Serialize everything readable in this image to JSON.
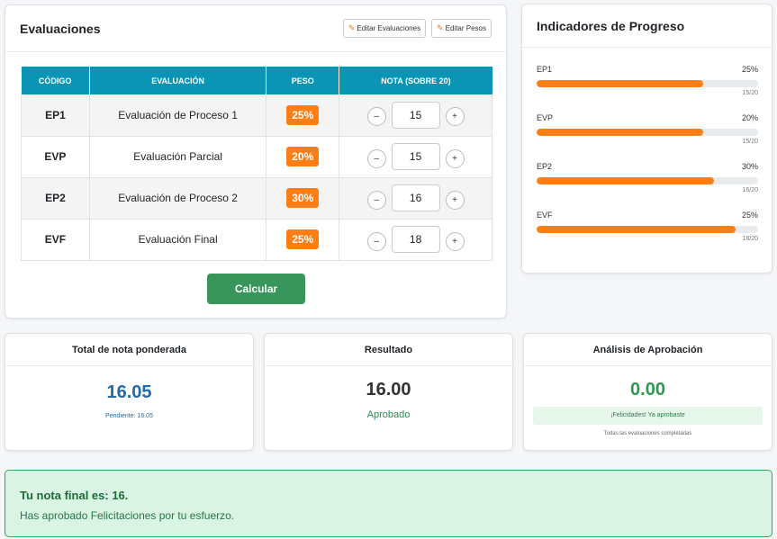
{
  "evaluaciones": {
    "title": "Evaluaciones",
    "edit_evals_label": "Editar Evaluaciones",
    "edit_weights_label": "Editar Pesos",
    "columns": [
      "CÓDIGO",
      "EVALUACIÓN",
      "PESO",
      "NOTA (SOBRE 20)"
    ],
    "rows": [
      {
        "code": "EP1",
        "name": "Evaluación de Proceso 1",
        "weight": "25%",
        "grade": "15"
      },
      {
        "code": "EVP",
        "name": "Evaluación Parcial",
        "weight": "20%",
        "grade": "15"
      },
      {
        "code": "EP2",
        "name": "Evaluación de Proceso 2",
        "weight": "30%",
        "grade": "16"
      },
      {
        "code": "EVF",
        "name": "Evaluación Final",
        "weight": "25%",
        "grade": "18"
      }
    ],
    "minus_symbol": "–",
    "plus_symbol": "+",
    "calculate_label": "Calcular"
  },
  "progreso": {
    "title": "Indicadores de Progreso",
    "items": [
      {
        "code": "EP1",
        "weight": "25%",
        "fraction": "15/20",
        "progress": 0.75
      },
      {
        "code": "EVP",
        "weight": "20%",
        "fraction": "15/20",
        "progress": 0.75
      },
      {
        "code": "EP2",
        "weight": "30%",
        "fraction": "16/20",
        "progress": 0.8
      },
      {
        "code": "EVF",
        "weight": "25%",
        "fraction": "18/20",
        "progress": 0.9
      }
    ]
  },
  "total": {
    "title": "Total de nota ponderada",
    "value": "16.05",
    "pending": "Pendiente: 16.05"
  },
  "resultado": {
    "title": "Resultado",
    "value": "16.00",
    "status": "Aprobado"
  },
  "analisis": {
    "title": "Análisis de Aprobación",
    "value": "0.00",
    "message": "¡Felicidades! Ya aprobaste",
    "note": "Todas las evaluaciones completadas"
  },
  "final": {
    "title": "Tu nota final es: 16.",
    "message": "Has aprobado Felicitaciones por tu esfuerzo."
  },
  "colors": {
    "accent_teal": "#0b95b5",
    "weight_orange": "#fd7e14",
    "success_green": "#38955b",
    "value_blue": "#1f6aa8"
  }
}
